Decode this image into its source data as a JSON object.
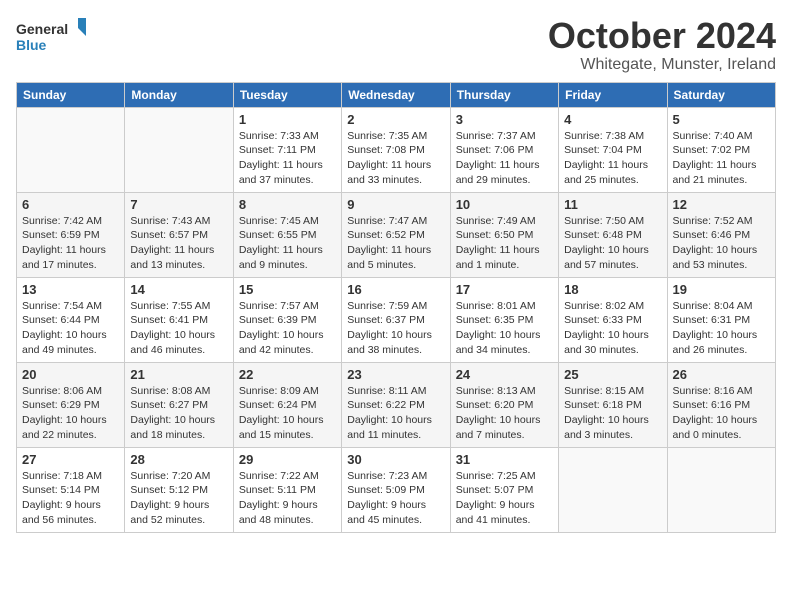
{
  "logo": {
    "line1": "General",
    "line2": "Blue"
  },
  "title": "October 2024",
  "subtitle": "Whitegate, Munster, Ireland",
  "days_of_week": [
    "Sunday",
    "Monday",
    "Tuesday",
    "Wednesday",
    "Thursday",
    "Friday",
    "Saturday"
  ],
  "weeks": [
    [
      {
        "day": "",
        "info": ""
      },
      {
        "day": "",
        "info": ""
      },
      {
        "day": "1",
        "info": "Sunrise: 7:33 AM\nSunset: 7:11 PM\nDaylight: 11 hours and 37 minutes."
      },
      {
        "day": "2",
        "info": "Sunrise: 7:35 AM\nSunset: 7:08 PM\nDaylight: 11 hours and 33 minutes."
      },
      {
        "day": "3",
        "info": "Sunrise: 7:37 AM\nSunset: 7:06 PM\nDaylight: 11 hours and 29 minutes."
      },
      {
        "day": "4",
        "info": "Sunrise: 7:38 AM\nSunset: 7:04 PM\nDaylight: 11 hours and 25 minutes."
      },
      {
        "day": "5",
        "info": "Sunrise: 7:40 AM\nSunset: 7:02 PM\nDaylight: 11 hours and 21 minutes."
      }
    ],
    [
      {
        "day": "6",
        "info": "Sunrise: 7:42 AM\nSunset: 6:59 PM\nDaylight: 11 hours and 17 minutes."
      },
      {
        "day": "7",
        "info": "Sunrise: 7:43 AM\nSunset: 6:57 PM\nDaylight: 11 hours and 13 minutes."
      },
      {
        "day": "8",
        "info": "Sunrise: 7:45 AM\nSunset: 6:55 PM\nDaylight: 11 hours and 9 minutes."
      },
      {
        "day": "9",
        "info": "Sunrise: 7:47 AM\nSunset: 6:52 PM\nDaylight: 11 hours and 5 minutes."
      },
      {
        "day": "10",
        "info": "Sunrise: 7:49 AM\nSunset: 6:50 PM\nDaylight: 11 hours and 1 minute."
      },
      {
        "day": "11",
        "info": "Sunrise: 7:50 AM\nSunset: 6:48 PM\nDaylight: 10 hours and 57 minutes."
      },
      {
        "day": "12",
        "info": "Sunrise: 7:52 AM\nSunset: 6:46 PM\nDaylight: 10 hours and 53 minutes."
      }
    ],
    [
      {
        "day": "13",
        "info": "Sunrise: 7:54 AM\nSunset: 6:44 PM\nDaylight: 10 hours and 49 minutes."
      },
      {
        "day": "14",
        "info": "Sunrise: 7:55 AM\nSunset: 6:41 PM\nDaylight: 10 hours and 46 minutes."
      },
      {
        "day": "15",
        "info": "Sunrise: 7:57 AM\nSunset: 6:39 PM\nDaylight: 10 hours and 42 minutes."
      },
      {
        "day": "16",
        "info": "Sunrise: 7:59 AM\nSunset: 6:37 PM\nDaylight: 10 hours and 38 minutes."
      },
      {
        "day": "17",
        "info": "Sunrise: 8:01 AM\nSunset: 6:35 PM\nDaylight: 10 hours and 34 minutes."
      },
      {
        "day": "18",
        "info": "Sunrise: 8:02 AM\nSunset: 6:33 PM\nDaylight: 10 hours and 30 minutes."
      },
      {
        "day": "19",
        "info": "Sunrise: 8:04 AM\nSunset: 6:31 PM\nDaylight: 10 hours and 26 minutes."
      }
    ],
    [
      {
        "day": "20",
        "info": "Sunrise: 8:06 AM\nSunset: 6:29 PM\nDaylight: 10 hours and 22 minutes."
      },
      {
        "day": "21",
        "info": "Sunrise: 8:08 AM\nSunset: 6:27 PM\nDaylight: 10 hours and 18 minutes."
      },
      {
        "day": "22",
        "info": "Sunrise: 8:09 AM\nSunset: 6:24 PM\nDaylight: 10 hours and 15 minutes."
      },
      {
        "day": "23",
        "info": "Sunrise: 8:11 AM\nSunset: 6:22 PM\nDaylight: 10 hours and 11 minutes."
      },
      {
        "day": "24",
        "info": "Sunrise: 8:13 AM\nSunset: 6:20 PM\nDaylight: 10 hours and 7 minutes."
      },
      {
        "day": "25",
        "info": "Sunrise: 8:15 AM\nSunset: 6:18 PM\nDaylight: 10 hours and 3 minutes."
      },
      {
        "day": "26",
        "info": "Sunrise: 8:16 AM\nSunset: 6:16 PM\nDaylight: 10 hours and 0 minutes."
      }
    ],
    [
      {
        "day": "27",
        "info": "Sunrise: 7:18 AM\nSunset: 5:14 PM\nDaylight: 9 hours and 56 minutes."
      },
      {
        "day": "28",
        "info": "Sunrise: 7:20 AM\nSunset: 5:12 PM\nDaylight: 9 hours and 52 minutes."
      },
      {
        "day": "29",
        "info": "Sunrise: 7:22 AM\nSunset: 5:11 PM\nDaylight: 9 hours and 48 minutes."
      },
      {
        "day": "30",
        "info": "Sunrise: 7:23 AM\nSunset: 5:09 PM\nDaylight: 9 hours and 45 minutes."
      },
      {
        "day": "31",
        "info": "Sunrise: 7:25 AM\nSunset: 5:07 PM\nDaylight: 9 hours and 41 minutes."
      },
      {
        "day": "",
        "info": ""
      },
      {
        "day": "",
        "info": ""
      }
    ]
  ]
}
